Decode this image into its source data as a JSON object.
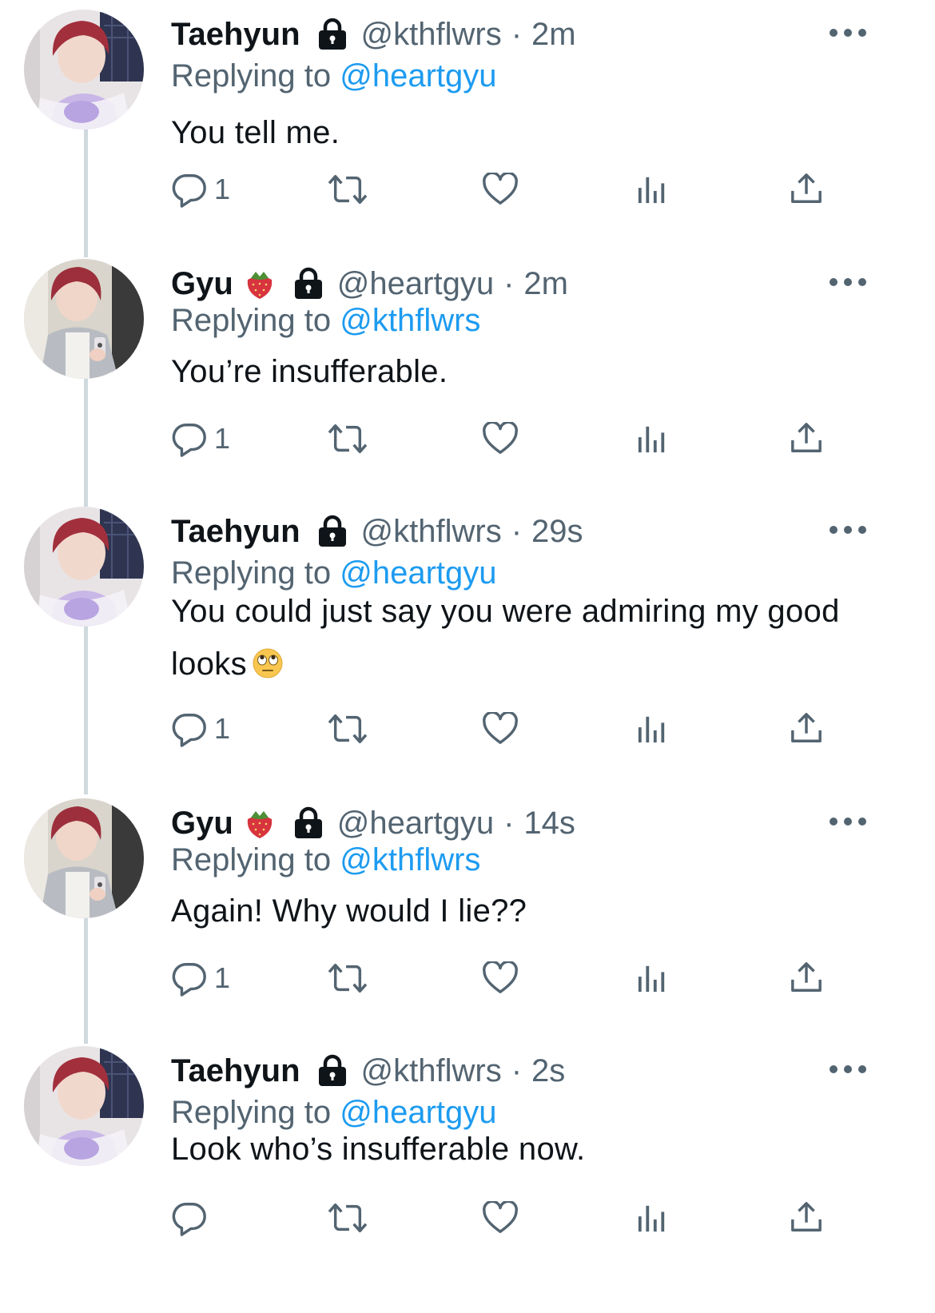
{
  "tweets": [
    {
      "name": "Taehyun",
      "name_emoji": "",
      "handle": "@kthflwrs",
      "separator": "·",
      "time": "2m",
      "replying_prefix": "Replying to",
      "replying_to": "@heartgyu",
      "text": "You tell me.",
      "reply_count": "1",
      "avatar": "taehyun-avatar",
      "locked": true
    },
    {
      "name": "Gyu",
      "name_emoji": "strawberry",
      "handle": "@heartgyu",
      "separator": "·",
      "time": "2m",
      "replying_prefix": "Replying to",
      "replying_to": "@kthflwrs",
      "text": "You’re insufferable.",
      "reply_count": "1",
      "avatar": "gyu-avatar",
      "locked": true
    },
    {
      "name": "Taehyun",
      "name_emoji": "",
      "handle": "@kthflwrs",
      "separator": "·",
      "time": "29s",
      "replying_prefix": "Replying to",
      "replying_to": "@heartgyu",
      "text_line1": "You could just say you were admiring my good",
      "text_line2": "looks",
      "text_emoji": "face-with-rolling-eyes",
      "reply_count": "1",
      "avatar": "taehyun-avatar",
      "locked": true
    },
    {
      "name": "Gyu",
      "name_emoji": "strawberry",
      "handle": "@heartgyu",
      "separator": "·",
      "time": "14s",
      "replying_prefix": "Replying to",
      "replying_to": "@kthflwrs",
      "text": "Again! Why would I lie??",
      "reply_count": "1",
      "avatar": "gyu-avatar",
      "locked": true
    },
    {
      "name": "Taehyun",
      "name_emoji": "",
      "handle": "@kthflwrs",
      "separator": "·",
      "time": "2s",
      "replying_prefix": "Replying to",
      "replying_to": "@heartgyu",
      "text": "Look who’s insufferable now.",
      "reply_count": "",
      "avatar": "taehyun-avatar",
      "locked": true
    }
  ],
  "colors": {
    "text": "#0f1419",
    "secondary": "#536471",
    "link": "#1d9bf0",
    "thread_line": "#cfd9de"
  },
  "icons": [
    "reply-icon",
    "retweet-icon",
    "like-icon",
    "views-icon",
    "share-icon",
    "lock-icon",
    "more-icon"
  ]
}
